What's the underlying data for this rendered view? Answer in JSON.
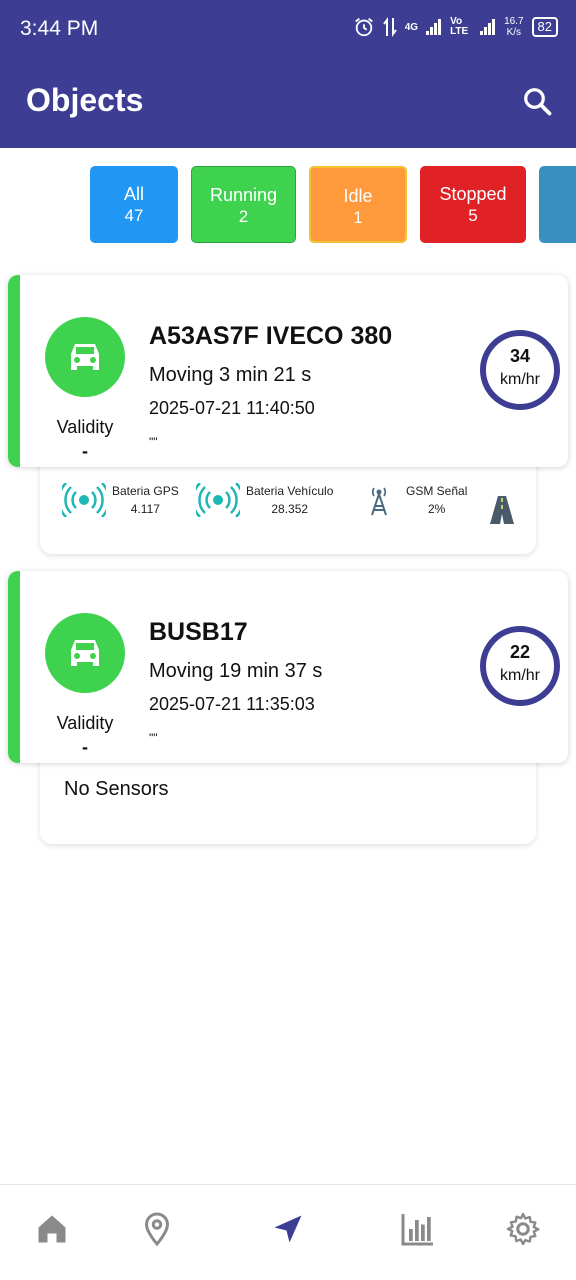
{
  "status_bar": {
    "time": "3:44 PM",
    "network": "4G",
    "volte": "Vo LTE",
    "speed_value": "16.7",
    "speed_unit": "K/s",
    "battery": "82"
  },
  "app_bar": {
    "title": "Objects"
  },
  "filters": [
    {
      "label": "All",
      "count": "47",
      "color": "#2196f3"
    },
    {
      "label": "Running",
      "count": "2",
      "color": "#3fd24f"
    },
    {
      "label": "Idle",
      "count": "1",
      "color": "#ff9a3c"
    },
    {
      "label": "Stopped",
      "count": "5",
      "color": "#e02125"
    }
  ],
  "vehicles": [
    {
      "name": "A53AS7F IVECO 380",
      "status": "Moving 3 min 21 s",
      "datetime": "2025-07-21 11:40:50",
      "note": "\"\"",
      "validity_label": "Validity",
      "validity_value": "-",
      "speed": "34",
      "speed_unit": "km/hr",
      "sensors": [
        {
          "label": "Bateria GPS",
          "value": "4.117",
          "icon": "signal-broadcast-icon"
        },
        {
          "label": "Bateria Vehículo",
          "value": "28.352",
          "icon": "signal-broadcast-icon"
        },
        {
          "label": "GSM Señal",
          "value": "2%",
          "icon": "cell-tower-icon"
        }
      ]
    },
    {
      "name": "BUSB17",
      "status": "Moving 19 min 37 s",
      "datetime": "2025-07-21 11:35:03",
      "note": "\"\"",
      "validity_label": "Validity",
      "validity_value": "-",
      "speed": "22",
      "speed_unit": "km/hr",
      "no_sensors": "No Sensors"
    }
  ],
  "bottom_nav": [
    "home-icon",
    "location-pin-icon",
    "navigation-arrow-icon",
    "bar-chart-icon",
    "settings-gear-icon"
  ],
  "colors": {
    "primary": "#3d3e93",
    "running": "#3fd24f"
  }
}
